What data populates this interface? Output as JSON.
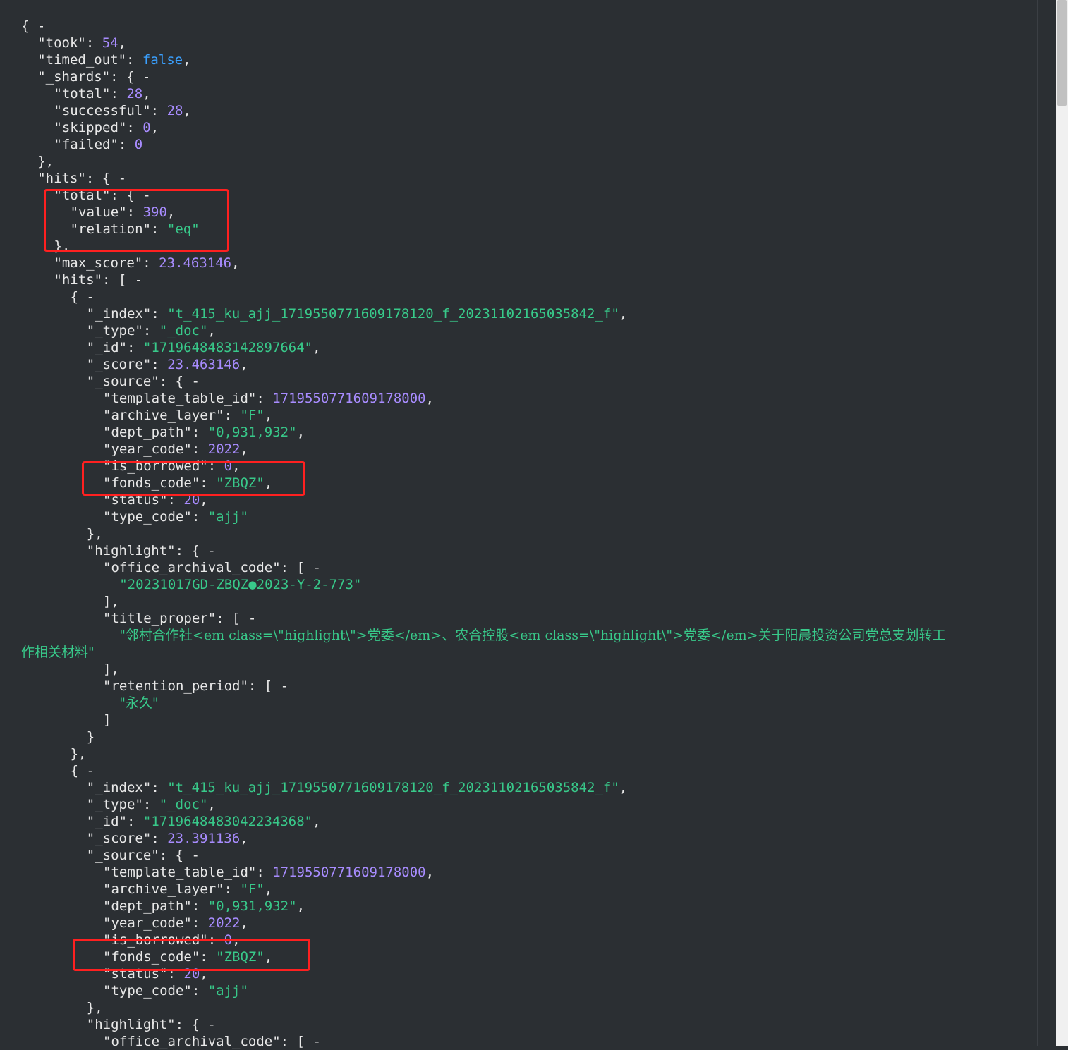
{
  "lines": [
    {
      "ind": 0,
      "t": [
        {
          "c": "p",
          "v": "{ "
        },
        {
          "c": "t",
          "v": "-"
        }
      ]
    },
    {
      "ind": 1,
      "t": [
        {
          "c": "k",
          "v": "\"took\""
        },
        {
          "c": "p",
          "v": ": "
        },
        {
          "c": "n",
          "v": "54"
        },
        {
          "c": "p",
          "v": ","
        }
      ]
    },
    {
      "ind": 1,
      "t": [
        {
          "c": "k",
          "v": "\"timed_out\""
        },
        {
          "c": "p",
          "v": ": "
        },
        {
          "c": "b",
          "v": "false"
        },
        {
          "c": "p",
          "v": ","
        }
      ]
    },
    {
      "ind": 1,
      "t": [
        {
          "c": "k",
          "v": "\"_shards\""
        },
        {
          "c": "p",
          "v": ": { "
        },
        {
          "c": "t",
          "v": "-"
        }
      ]
    },
    {
      "ind": 2,
      "t": [
        {
          "c": "k",
          "v": "\"total\""
        },
        {
          "c": "p",
          "v": ": "
        },
        {
          "c": "n",
          "v": "28"
        },
        {
          "c": "p",
          "v": ","
        }
      ]
    },
    {
      "ind": 2,
      "t": [
        {
          "c": "k",
          "v": "\"successful\""
        },
        {
          "c": "p",
          "v": ": "
        },
        {
          "c": "n",
          "v": "28"
        },
        {
          "c": "p",
          "v": ","
        }
      ]
    },
    {
      "ind": 2,
      "t": [
        {
          "c": "k",
          "v": "\"skipped\""
        },
        {
          "c": "p",
          "v": ": "
        },
        {
          "c": "n",
          "v": "0"
        },
        {
          "c": "p",
          "v": ","
        }
      ]
    },
    {
      "ind": 2,
      "t": [
        {
          "c": "k",
          "v": "\"failed\""
        },
        {
          "c": "p",
          "v": ": "
        },
        {
          "c": "n",
          "v": "0"
        }
      ]
    },
    {
      "ind": 1,
      "t": [
        {
          "c": "p",
          "v": "},"
        }
      ]
    },
    {
      "ind": 1,
      "t": [
        {
          "c": "k",
          "v": "\"hits\""
        },
        {
          "c": "p",
          "v": ": { "
        },
        {
          "c": "t",
          "v": "-"
        }
      ]
    },
    {
      "ind": 2,
      "t": [
        {
          "c": "k",
          "v": "\"total\""
        },
        {
          "c": "p",
          "v": ": { "
        },
        {
          "c": "t",
          "v": "-"
        }
      ]
    },
    {
      "ind": 3,
      "t": [
        {
          "c": "k",
          "v": "\"value\""
        },
        {
          "c": "p",
          "v": ": "
        },
        {
          "c": "n",
          "v": "390"
        },
        {
          "c": "p",
          "v": ","
        }
      ]
    },
    {
      "ind": 3,
      "t": [
        {
          "c": "k",
          "v": "\"relation\""
        },
        {
          "c": "p",
          "v": ": "
        },
        {
          "c": "s",
          "v": "\"eq\""
        }
      ]
    },
    {
      "ind": 2,
      "t": [
        {
          "c": "p",
          "v": "},"
        }
      ]
    },
    {
      "ind": 2,
      "t": [
        {
          "c": "k",
          "v": "\"max_score\""
        },
        {
          "c": "p",
          "v": ": "
        },
        {
          "c": "n",
          "v": "23.463146"
        },
        {
          "c": "p",
          "v": ","
        }
      ]
    },
    {
      "ind": 2,
      "t": [
        {
          "c": "k",
          "v": "\"hits\""
        },
        {
          "c": "p",
          "v": ": [ "
        },
        {
          "c": "t",
          "v": "-"
        }
      ]
    },
    {
      "ind": 3,
      "t": [
        {
          "c": "p",
          "v": "{ "
        },
        {
          "c": "t",
          "v": "-"
        }
      ]
    },
    {
      "ind": 4,
      "t": [
        {
          "c": "k",
          "v": "\"_index\""
        },
        {
          "c": "p",
          "v": ": "
        },
        {
          "c": "s",
          "v": "\"t_415_ku_ajj_1719550771609178120_f_20231102165035842_f\""
        },
        {
          "c": "p",
          "v": ","
        }
      ]
    },
    {
      "ind": 4,
      "t": [
        {
          "c": "k",
          "v": "\"_type\""
        },
        {
          "c": "p",
          "v": ": "
        },
        {
          "c": "s",
          "v": "\"_doc\""
        },
        {
          "c": "p",
          "v": ","
        }
      ]
    },
    {
      "ind": 4,
      "t": [
        {
          "c": "k",
          "v": "\"_id\""
        },
        {
          "c": "p",
          "v": ": "
        },
        {
          "c": "s",
          "v": "\"1719648483142897664\""
        },
        {
          "c": "p",
          "v": ","
        }
      ]
    },
    {
      "ind": 4,
      "t": [
        {
          "c": "k",
          "v": "\"_score\""
        },
        {
          "c": "p",
          "v": ": "
        },
        {
          "c": "n",
          "v": "23.463146"
        },
        {
          "c": "p",
          "v": ","
        }
      ]
    },
    {
      "ind": 4,
      "t": [
        {
          "c": "k",
          "v": "\"_source\""
        },
        {
          "c": "p",
          "v": ": { "
        },
        {
          "c": "t",
          "v": "-"
        }
      ]
    },
    {
      "ind": 5,
      "t": [
        {
          "c": "k",
          "v": "\"template_table_id\""
        },
        {
          "c": "p",
          "v": ": "
        },
        {
          "c": "n",
          "v": "1719550771609178000"
        },
        {
          "c": "p",
          "v": ","
        }
      ]
    },
    {
      "ind": 5,
      "t": [
        {
          "c": "k",
          "v": "\"archive_layer\""
        },
        {
          "c": "p",
          "v": ": "
        },
        {
          "c": "s",
          "v": "\"F\""
        },
        {
          "c": "p",
          "v": ","
        }
      ]
    },
    {
      "ind": 5,
      "t": [
        {
          "c": "k",
          "v": "\"dept_path\""
        },
        {
          "c": "p",
          "v": ": "
        },
        {
          "c": "s",
          "v": "\"0,931,932\""
        },
        {
          "c": "p",
          "v": ","
        }
      ]
    },
    {
      "ind": 5,
      "t": [
        {
          "c": "k",
          "v": "\"year_code\""
        },
        {
          "c": "p",
          "v": ": "
        },
        {
          "c": "n",
          "v": "2022"
        },
        {
          "c": "p",
          "v": ","
        }
      ]
    },
    {
      "ind": 5,
      "t": [
        {
          "c": "k",
          "v": "\"is_borrowed\""
        },
        {
          "c": "p",
          "v": ": "
        },
        {
          "c": "n",
          "v": "0"
        },
        {
          "c": "p",
          "v": ","
        }
      ]
    },
    {
      "ind": 5,
      "t": [
        {
          "c": "k",
          "v": "\"fonds_code\""
        },
        {
          "c": "p",
          "v": ": "
        },
        {
          "c": "s",
          "v": "\"ZBQZ\""
        },
        {
          "c": "p",
          "v": ","
        }
      ]
    },
    {
      "ind": 5,
      "t": [
        {
          "c": "k",
          "v": "\"status\""
        },
        {
          "c": "p",
          "v": ": "
        },
        {
          "c": "n",
          "v": "20"
        },
        {
          "c": "p",
          "v": ","
        }
      ]
    },
    {
      "ind": 5,
      "t": [
        {
          "c": "k",
          "v": "\"type_code\""
        },
        {
          "c": "p",
          "v": ": "
        },
        {
          "c": "s",
          "v": "\"ajj\""
        }
      ]
    },
    {
      "ind": 4,
      "t": [
        {
          "c": "p",
          "v": "},"
        }
      ]
    },
    {
      "ind": 4,
      "t": [
        {
          "c": "k",
          "v": "\"highlight\""
        },
        {
          "c": "p",
          "v": ": { "
        },
        {
          "c": "t",
          "v": "-"
        }
      ]
    },
    {
      "ind": 5,
      "t": [
        {
          "c": "k",
          "v": "\"office_archival_code\""
        },
        {
          "c": "p",
          "v": ": [ "
        },
        {
          "c": "t",
          "v": "-"
        }
      ]
    },
    {
      "ind": 6,
      "t": [
        {
          "c": "s",
          "v": "\"20231017GD-ZBQZ●2023-Y-2-773\""
        }
      ]
    },
    {
      "ind": 5,
      "t": [
        {
          "c": "p",
          "v": "],"
        }
      ]
    },
    {
      "ind": 5,
      "t": [
        {
          "c": "k",
          "v": "\"title_proper\""
        },
        {
          "c": "p",
          "v": ": [ "
        },
        {
          "c": "t",
          "v": "-"
        }
      ]
    },
    {
      "ind": 6,
      "t": [
        {
          "c": "s",
          "v": "\"邻村合作社<em class=\\\"highlight\\\">党委</em>、农合控股<em class=\\\"highlight\\\">党委</em>关于阳晨投资公司党总支划转工"
        }
      ]
    },
    {
      "ind": 0,
      "t": [
        {
          "c": "s",
          "v": "作相关材料\""
        }
      ]
    },
    {
      "ind": 5,
      "t": [
        {
          "c": "p",
          "v": "],"
        }
      ]
    },
    {
      "ind": 5,
      "t": [
        {
          "c": "k",
          "v": "\"retention_period\""
        },
        {
          "c": "p",
          "v": ": [ "
        },
        {
          "c": "t",
          "v": "-"
        }
      ]
    },
    {
      "ind": 6,
      "t": [
        {
          "c": "s",
          "v": "\"永久\""
        }
      ]
    },
    {
      "ind": 5,
      "t": [
        {
          "c": "p",
          "v": "]"
        }
      ]
    },
    {
      "ind": 4,
      "t": [
        {
          "c": "p",
          "v": "}"
        }
      ]
    },
    {
      "ind": 3,
      "t": [
        {
          "c": "p",
          "v": "},"
        }
      ]
    },
    {
      "ind": 3,
      "t": [
        {
          "c": "p",
          "v": "{ "
        },
        {
          "c": "t",
          "v": "-"
        }
      ]
    },
    {
      "ind": 4,
      "t": [
        {
          "c": "k",
          "v": "\"_index\""
        },
        {
          "c": "p",
          "v": ": "
        },
        {
          "c": "s",
          "v": "\"t_415_ku_ajj_1719550771609178120_f_20231102165035842_f\""
        },
        {
          "c": "p",
          "v": ","
        }
      ]
    },
    {
      "ind": 4,
      "t": [
        {
          "c": "k",
          "v": "\"_type\""
        },
        {
          "c": "p",
          "v": ": "
        },
        {
          "c": "s",
          "v": "\"_doc\""
        },
        {
          "c": "p",
          "v": ","
        }
      ]
    },
    {
      "ind": 4,
      "t": [
        {
          "c": "k",
          "v": "\"_id\""
        },
        {
          "c": "p",
          "v": ": "
        },
        {
          "c": "s",
          "v": "\"1719648483042234368\""
        },
        {
          "c": "p",
          "v": ","
        }
      ]
    },
    {
      "ind": 4,
      "t": [
        {
          "c": "k",
          "v": "\"_score\""
        },
        {
          "c": "p",
          "v": ": "
        },
        {
          "c": "n",
          "v": "23.391136"
        },
        {
          "c": "p",
          "v": ","
        }
      ]
    },
    {
      "ind": 4,
      "t": [
        {
          "c": "k",
          "v": "\"_source\""
        },
        {
          "c": "p",
          "v": ": { "
        },
        {
          "c": "t",
          "v": "-"
        }
      ]
    },
    {
      "ind": 5,
      "t": [
        {
          "c": "k",
          "v": "\"template_table_id\""
        },
        {
          "c": "p",
          "v": ": "
        },
        {
          "c": "n",
          "v": "1719550771609178000"
        },
        {
          "c": "p",
          "v": ","
        }
      ]
    },
    {
      "ind": 5,
      "t": [
        {
          "c": "k",
          "v": "\"archive_layer\""
        },
        {
          "c": "p",
          "v": ": "
        },
        {
          "c": "s",
          "v": "\"F\""
        },
        {
          "c": "p",
          "v": ","
        }
      ]
    },
    {
      "ind": 5,
      "t": [
        {
          "c": "k",
          "v": "\"dept_path\""
        },
        {
          "c": "p",
          "v": ": "
        },
        {
          "c": "s",
          "v": "\"0,931,932\""
        },
        {
          "c": "p",
          "v": ","
        }
      ]
    },
    {
      "ind": 5,
      "t": [
        {
          "c": "k",
          "v": "\"year_code\""
        },
        {
          "c": "p",
          "v": ": "
        },
        {
          "c": "n",
          "v": "2022"
        },
        {
          "c": "p",
          "v": ","
        }
      ]
    },
    {
      "ind": 5,
      "t": [
        {
          "c": "k",
          "v": "\"is_borrowed\""
        },
        {
          "c": "p",
          "v": ": "
        },
        {
          "c": "n",
          "v": "0"
        },
        {
          "c": "p",
          "v": ","
        }
      ]
    },
    {
      "ind": 5,
      "t": [
        {
          "c": "k",
          "v": "\"fonds_code\""
        },
        {
          "c": "p",
          "v": ": "
        },
        {
          "c": "s",
          "v": "\"ZBQZ\""
        },
        {
          "c": "p",
          "v": ","
        }
      ]
    },
    {
      "ind": 5,
      "t": [
        {
          "c": "k",
          "v": "\"status\""
        },
        {
          "c": "p",
          "v": ": "
        },
        {
          "c": "n",
          "v": "20"
        },
        {
          "c": "p",
          "v": ","
        }
      ]
    },
    {
      "ind": 5,
      "t": [
        {
          "c": "k",
          "v": "\"type_code\""
        },
        {
          "c": "p",
          "v": ": "
        },
        {
          "c": "s",
          "v": "\"ajj\""
        }
      ]
    },
    {
      "ind": 4,
      "t": [
        {
          "c": "p",
          "v": "},"
        }
      ]
    },
    {
      "ind": 4,
      "t": [
        {
          "c": "k",
          "v": "\"highlight\""
        },
        {
          "c": "p",
          "v": ": { "
        },
        {
          "c": "t",
          "v": "-"
        }
      ]
    },
    {
      "ind": 5,
      "t": [
        {
          "c": "k",
          "v": "\"office_archival_code\""
        },
        {
          "c": "p",
          "v": ": [ "
        },
        {
          "c": "t",
          "v": "-"
        }
      ]
    }
  ],
  "colors": {
    "background": "#2b2f33",
    "key": "#e8e8e8",
    "number": "#a88cff",
    "string": "#38c98a",
    "boolean": "#3aa0ff",
    "annotation_box": "#ff2020"
  }
}
